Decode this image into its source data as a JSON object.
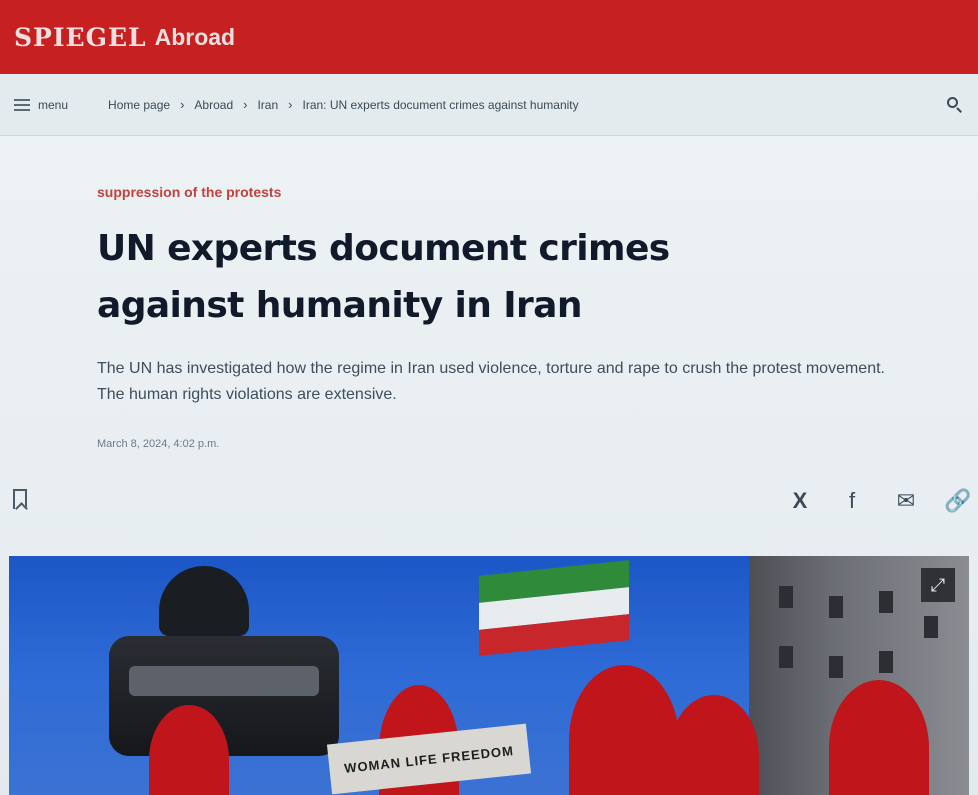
{
  "header": {
    "logo": "SPIEGEL",
    "section": "Abroad"
  },
  "nav": {
    "menu_label": "menu",
    "breadcrumbs": [
      "Home page",
      "Abroad",
      "Iran",
      "Iran: UN experts document crimes against humanity"
    ],
    "separator": "›",
    "search_icon": "search-icon"
  },
  "article": {
    "kicker": "suppression of the protests",
    "headline": "UN experts document crimes against humanity in Iran",
    "teaser": "The UN has investigated how the regime in Iran used violence, torture and rape to crush the protest movement. The human rights violations are extensive.",
    "date": "March 8, 2024, 4:02 p.m."
  },
  "actions": {
    "bookmark_icon": "bookmark-icon",
    "share": [
      {
        "name": "x",
        "glyph": "X"
      },
      {
        "name": "facebook",
        "glyph": "f"
      },
      {
        "name": "email",
        "glyph": "✉"
      },
      {
        "name": "link",
        "glyph": "🔗"
      }
    ]
  },
  "hero": {
    "banner_text": "WOMAN LIFE FREEDOM",
    "expand_glyph": "⤢"
  },
  "colors": {
    "brand_red": "#c62021",
    "kicker_red": "#c3423f",
    "headline": "#111a2a"
  }
}
